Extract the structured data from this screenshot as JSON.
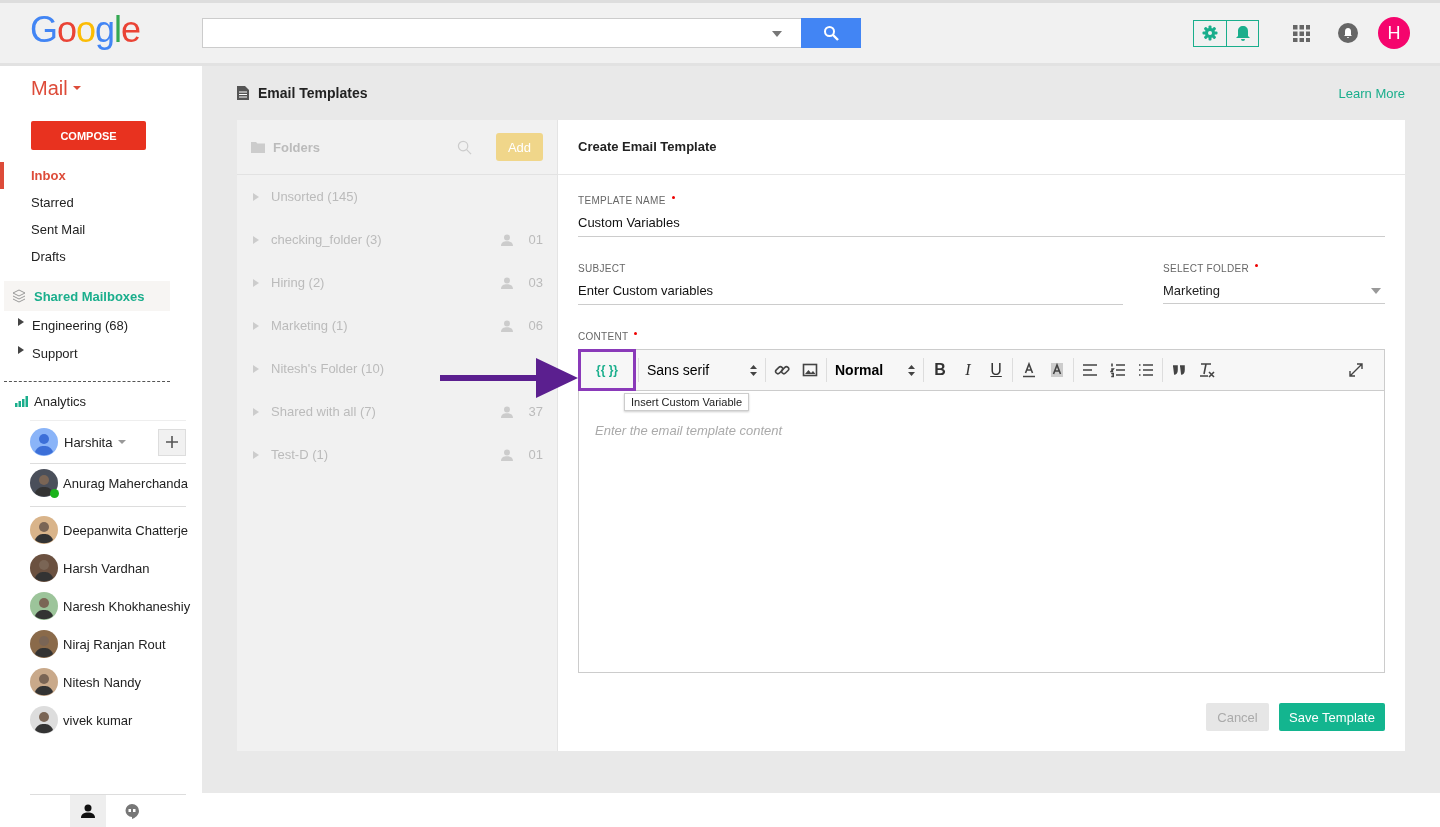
{
  "header": {
    "logo": "Google",
    "avatar_letter": "H"
  },
  "sidebar": {
    "app": "Mail",
    "compose": "COMPOSE",
    "items": [
      {
        "label": "Inbox",
        "selected": true
      },
      {
        "label": "Starred",
        "selected": false
      },
      {
        "label": "Sent Mail",
        "selected": false
      },
      {
        "label": "Drafts",
        "selected": false
      }
    ],
    "shared": {
      "label": "Shared Mailboxes",
      "items": [
        {
          "label": "Engineering (68)"
        },
        {
          "label": "Support"
        }
      ]
    },
    "analytics": "Analytics",
    "chat": {
      "user": "Harshita",
      "contacts": [
        {
          "name": "Anurag Maherchanda",
          "online": true
        },
        {
          "name": "Deepanwita Chatterje",
          "online": false
        },
        {
          "name": "Harsh Vardhan",
          "online": false
        },
        {
          "name": "Naresh Khokhaneshiy",
          "online": false
        },
        {
          "name": "Niraj Ranjan Rout",
          "online": false
        },
        {
          "name": "Nitesh Nandy",
          "online": false
        },
        {
          "name": "vivek kumar",
          "online": false
        }
      ]
    }
  },
  "page": {
    "title": "Email Templates",
    "learn_more": "Learn More"
  },
  "folders": {
    "title": "Folders",
    "add": "Add",
    "items": [
      {
        "name": "Unsorted (145)"
      },
      {
        "name": "checking_folder (3)",
        "members": "01"
      },
      {
        "name": "Hiring (2)",
        "members": "03"
      },
      {
        "name": "Marketing (1)",
        "members": "06"
      },
      {
        "name": "Nitesh's Folder (10)"
      },
      {
        "name": "Shared with all (7)",
        "members": "37"
      },
      {
        "name": "Test-D (1)",
        "members": "01"
      }
    ]
  },
  "form": {
    "title": "Create Email Template",
    "template_name": {
      "label": "TEMPLATE NAME",
      "required": true,
      "value": "Custom Variables"
    },
    "subject": {
      "label": "SUBJECT",
      "value": "Enter Custom variables"
    },
    "folder": {
      "label": "SELECT FOLDER",
      "required": true,
      "value": "Marketing"
    },
    "content": {
      "label": "CONTENT",
      "required": true,
      "placeholder": "Enter the email template content"
    },
    "toolbar": [
      {
        "kind": "variable",
        "text": "{{ }}",
        "highlighted": true
      },
      {
        "kind": "select",
        "text": "Sans serif"
      },
      {
        "kind": "link"
      },
      {
        "kind": "image"
      },
      {
        "kind": "select",
        "text": "Normal"
      },
      {
        "kind": "bold",
        "text": "B"
      },
      {
        "kind": "italic",
        "text": "I"
      },
      {
        "kind": "underline",
        "text": "U"
      },
      {
        "kind": "textcolor"
      },
      {
        "kind": "highlight"
      },
      {
        "kind": "align"
      },
      {
        "kind": "numbered"
      },
      {
        "kind": "bullets"
      },
      {
        "kind": "quote"
      },
      {
        "kind": "clear"
      }
    ],
    "tooltip": "Insert Custom Variable",
    "cancel": {
      "label": "Cancel",
      "disabled": true
    },
    "save": "Save Template"
  }
}
